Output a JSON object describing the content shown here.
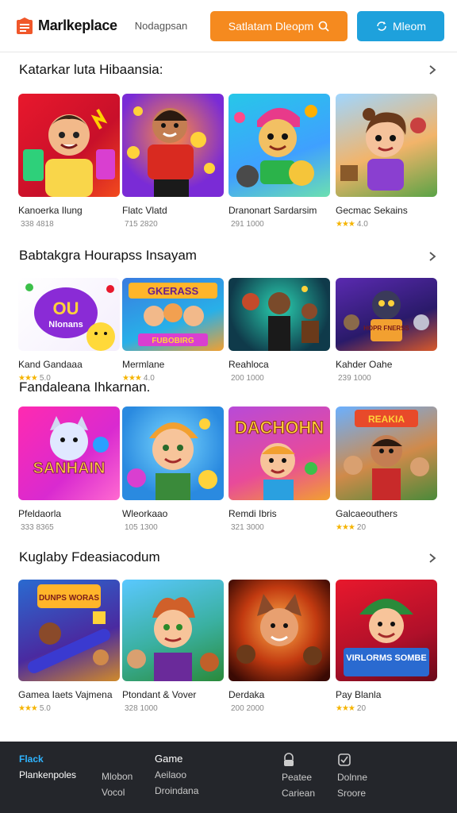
{
  "header": {
    "logo_text": "Marlkeplace",
    "nav_link": "Nodagpsan",
    "search_button": "Satlatam Dleopm",
    "action_button": "Mleom"
  },
  "colors": {
    "orange": "#f58a1f",
    "blue": "#1ea1dc",
    "nav_bg": "#24262b",
    "active": "#2fb4ff",
    "star": "#f5b400"
  },
  "sections": [
    {
      "title": "Katarkar luta Hibaansia:",
      "cards": [
        {
          "title": "Kanoerka Ilung",
          "sub": "338 4818",
          "rating": ""
        },
        {
          "title": "Flatc Vlatd",
          "sub": "715 2820",
          "rating": ""
        },
        {
          "title": "Dranonart Sardarsim",
          "sub": "291 1000",
          "rating": ""
        },
        {
          "title": "Gecmac Sekains",
          "sub": "4.0",
          "rating": "★★★"
        }
      ]
    },
    {
      "title": "Babtakgra Hourapss Insayam",
      "cards": [
        {
          "title": "Kand Gandaaa",
          "sub": "5.0",
          "rating": "★★★"
        },
        {
          "title": "Mermlane",
          "sub": "4.0",
          "rating": "★★★"
        },
        {
          "title": "Reahloca",
          "sub": "200 1000",
          "rating": ""
        },
        {
          "title": "Kahder Oahe",
          "sub": "239 1000",
          "rating": ""
        }
      ]
    },
    {
      "title": "Fandaleana Ihkarnan.",
      "cards": [
        {
          "title": "Pfeldaorla",
          "sub": "333 8365",
          "rating": ""
        },
        {
          "title": "Wleorkaao",
          "sub": "105 1300",
          "rating": ""
        },
        {
          "title": "Remdi Ibris",
          "sub": "321 3000",
          "rating": ""
        },
        {
          "title": "Galcaeouthers",
          "sub": "20",
          "rating": "★★★"
        }
      ]
    },
    {
      "title": "Kuglaby Fdeasiacodum",
      "cards": [
        {
          "title": "Gamea Iaets Vajmena",
          "sub": "5.0",
          "rating": "★★★"
        },
        {
          "title": "Ptondant & Vover",
          "sub": "328 1000",
          "rating": ""
        },
        {
          "title": "Derdaka",
          "sub": "200 2000",
          "rating": ""
        },
        {
          "title": "Pay Blanla",
          "sub": "20",
          "rating": "★★★"
        }
      ]
    }
  ],
  "thumb_captions": {
    "t2_0": "OU",
    "t2_0b": "Nlonans",
    "t2_1": "GKERASS",
    "t2_1b": "FUBOBIRG",
    "t2_3": "HOPR FNERSS",
    "t3_0": "SANHAIN",
    "t3_2": "DACHOHN",
    "t3_3": "REAKIA",
    "t4_0": "DUNPS WORAS",
    "t4_3": "VIRLORMS SOMBE"
  },
  "bottom_nav": {
    "col1": {
      "l1": "Flack",
      "l2": "Plankenpoles"
    },
    "col2": {
      "l1": "Mlobon",
      "l2": "Vocol"
    },
    "col3": {
      "l0": "Game",
      "l1": "Aeilaoo",
      "l2": "Droindana"
    },
    "col4": {
      "l1": "Peatee",
      "l2": "Cariean"
    },
    "col5": {
      "l1": "Dolnne",
      "l2": "Sroore"
    }
  }
}
